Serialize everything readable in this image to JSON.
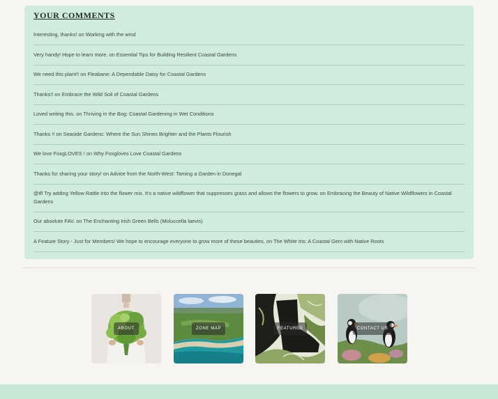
{
  "comments_section": {
    "title": "YOUR COMMENTS",
    "items": [
      {
        "comment": "Interesting, thanks!",
        "joiner": "on",
        "post": "Working with the wind"
      },
      {
        "comment": "Very handy! Hope to learn more.",
        "joiner": "on",
        "post": "Essential Tips for Building Resilient Coastal Gardens"
      },
      {
        "comment": "We need this plant!!",
        "joiner": "on",
        "post": "Fleabane: A Dependable Daisy for Coastal Gardens"
      },
      {
        "comment": "Thanks!!",
        "joiner": "on",
        "post": "Embrace the Wild Soil of Coastal Gardens"
      },
      {
        "comment": "Loved writing this.",
        "joiner": "on",
        "post": "Thriving in the Bog: Coastal Gardening in Wet Conditions"
      },
      {
        "comment": "Thanks !!",
        "joiner": "on",
        "post": "Seaside Gardens: Where the Sun Shines Brighter and the Plants Flourish"
      },
      {
        "comment": "We love FoxgLOVES !",
        "joiner": "on",
        "post": "Why Foxgloves Love Coastal Gardens"
      },
      {
        "comment": "Thanks for sharing your story!",
        "joiner": "on",
        "post": "Advice from the North-West: Taming a Garden in Donegal"
      },
      {
        "comment": "@tfl Try adding Yellow Rattle into the flower mix. It's a native wildflower that suppresses grass and allows the flowers to grow.",
        "joiner": "on",
        "post": "Embracing the Beauty of Native Wildflowers in Coastal Gardens"
      },
      {
        "comment": "Our absolute FAV.",
        "joiner": "on",
        "post": "The Enchanting Irish Green Bells (Moluccella laevis)"
      },
      {
        "comment": "A Feature Story - Just for Members! We hope to encourage everyone to grow more of these beauties.",
        "joiner": "on",
        "post": "The White Iris: A Coastal Gem with Native Roots"
      }
    ]
  },
  "nav_tiles": [
    {
      "label": "ABOUT",
      "icon": "woman-holding-greenery-image"
    },
    {
      "label": "ZONE MAP",
      "icon": "coastal-bay-aerial-image"
    },
    {
      "label": "FEATURES",
      "icon": "botanical-print-boot-image"
    },
    {
      "label": "CONTACT US",
      "icon": "puffins-on-cliff-image"
    }
  ],
  "colors": {
    "page_bg": "#f7f5f2",
    "panel_bg": "#d1ebdd",
    "footer_bg": "#c8e6d4",
    "text": "#3a4a40"
  }
}
